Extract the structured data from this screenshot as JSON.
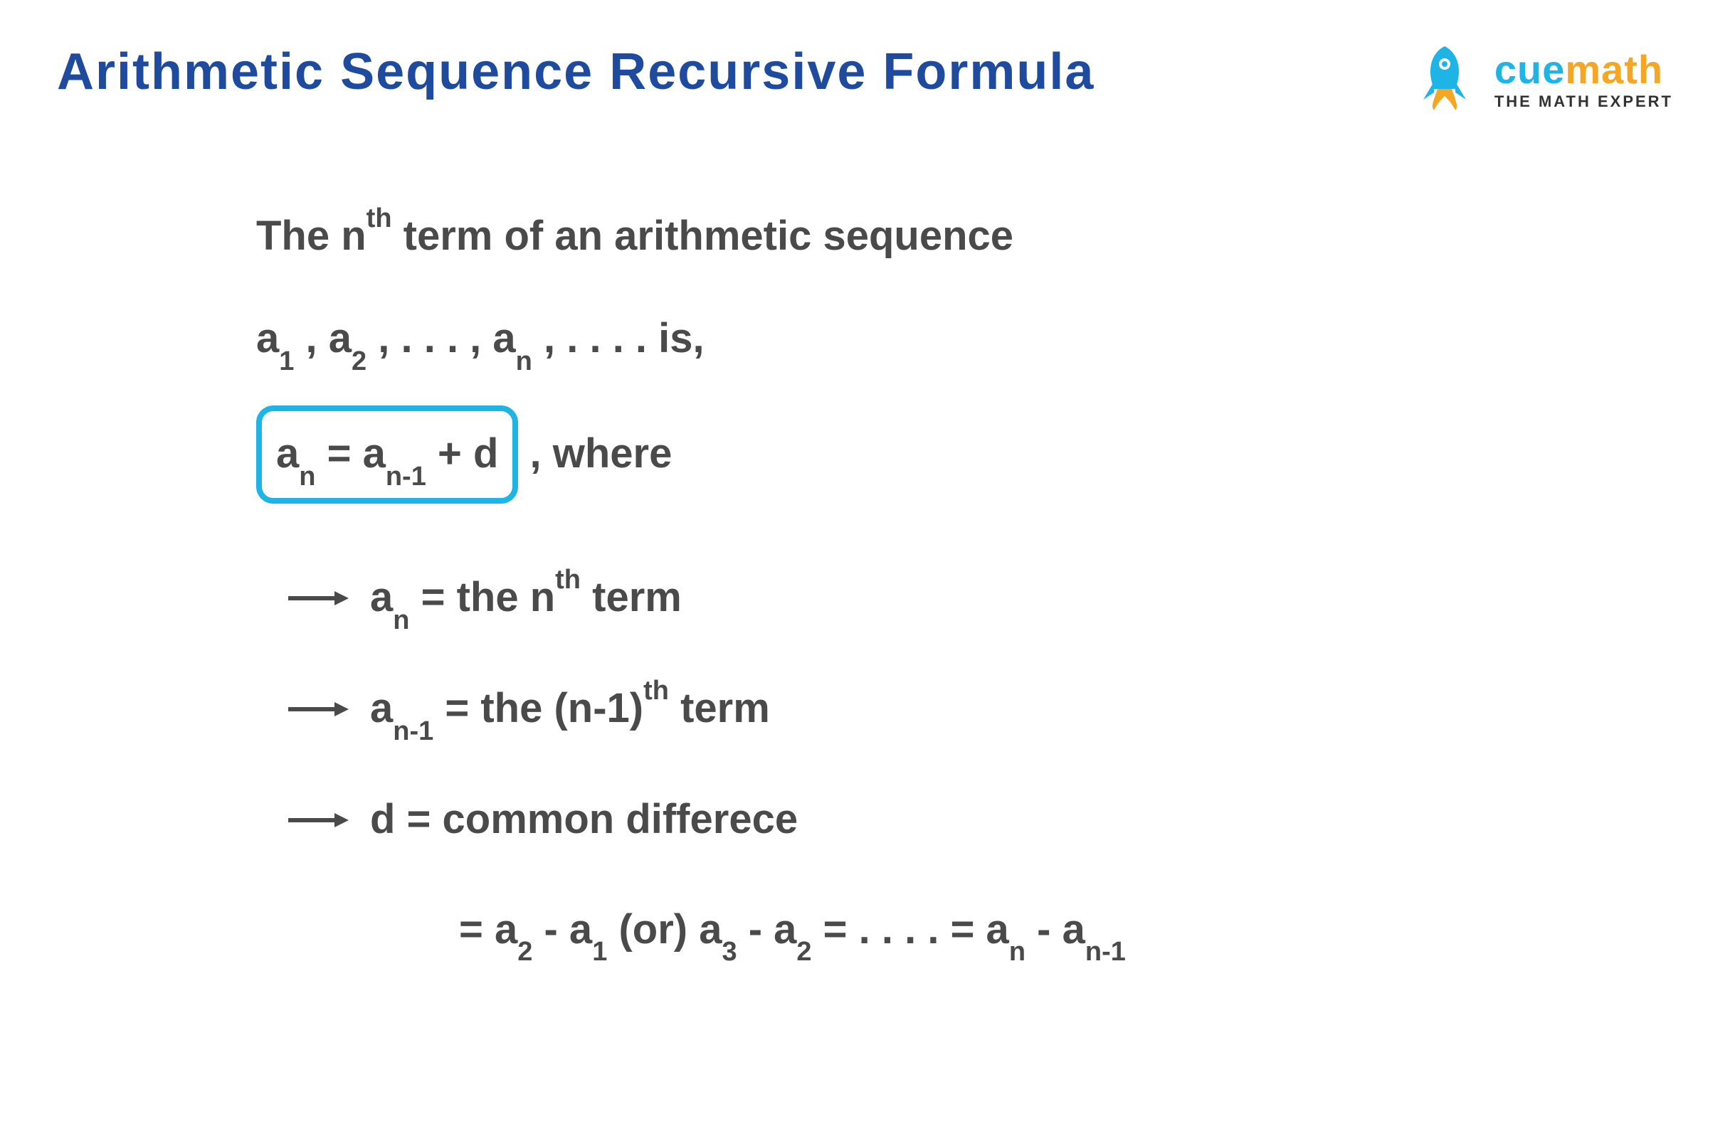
{
  "title": "Arithmetic Sequence Recursive Formula",
  "logo": {
    "cue": "cue",
    "math": "math",
    "tagline": "THE MATH EXPERT"
  },
  "content": {
    "line1_a": "The n",
    "line1_sup": "th",
    "line1_b": " term of an arithmetic sequence",
    "line2_a1": "a",
    "line2_s1": "1",
    "line2_c1": " , a",
    "line2_s2": "2",
    "line2_c2": " , . . . , a",
    "line2_sn": "n",
    "line2_c3": " , . . . .   is,",
    "formula_a": "a",
    "formula_sn": "n",
    "formula_eq": " =  a",
    "formula_sn1": "n-1",
    "formula_d": " + d",
    "where": " ,  where",
    "bullet1_a": "a",
    "bullet1_sn": "n",
    "bullet1_eq": " =  the n",
    "bullet1_sup": "th",
    "bullet1_b": " term",
    "bullet2_a": "a",
    "bullet2_sn": "n-1",
    "bullet2_eq": "  =  the (n-1)",
    "bullet2_sup": "th",
    "bullet2_b": " term",
    "bullet3_a": "d  =  common differece",
    "cont_eq": "=  a",
    "cont_s2": "2",
    "cont_m1": " - a",
    "cont_s1": "1",
    "cont_or": " (or) a",
    "cont_s3": "3",
    "cont_m2": " - a",
    "cont_s2b": "2",
    "cont_dots": " = . . . . =  a",
    "cont_sn": "n",
    "cont_m3": " - a",
    "cont_sn1": "n-1"
  }
}
